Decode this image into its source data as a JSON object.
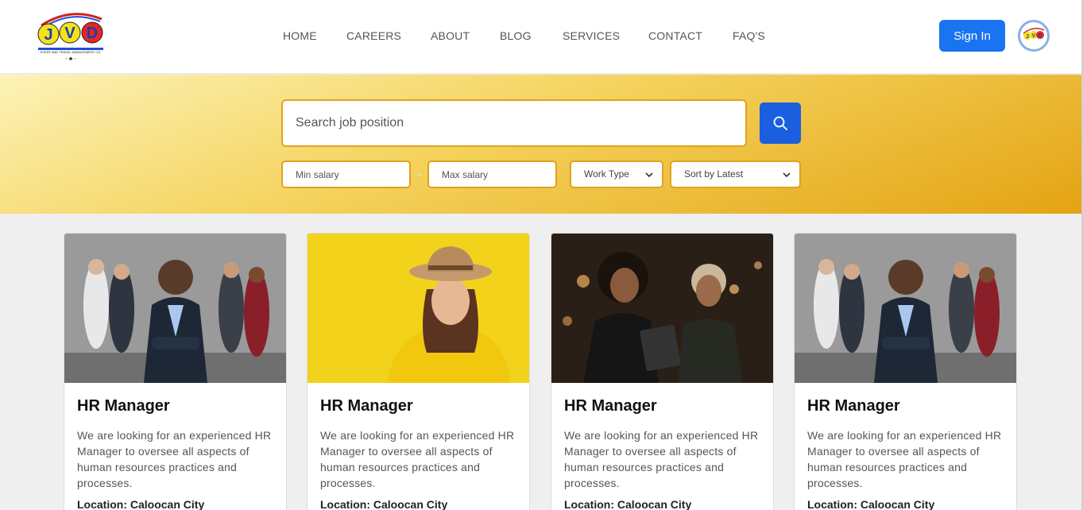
{
  "brand": {
    "logo_text": "JVD",
    "logo_tagline": "EVENT AND TRAVEL MANAGEMENT CO."
  },
  "nav": {
    "items": [
      {
        "label": "HOME"
      },
      {
        "label": "CAREERS"
      },
      {
        "label": "ABOUT"
      },
      {
        "label": "BLOG"
      },
      {
        "label": "SERVICES"
      },
      {
        "label": "CONTACT"
      },
      {
        "label": "FAQ'S"
      }
    ],
    "signin_label": "Sign In"
  },
  "search": {
    "placeholder": "Search job position",
    "min_salary_placeholder": "Min salary",
    "max_salary_placeholder": "Max salary",
    "range_separator": "-",
    "work_type": "Work Type",
    "sort": "Sort by Latest",
    "icon": "search-icon"
  },
  "colors": {
    "accent_blue": "#1a73f0",
    "hero_gold": "#e4a313",
    "border_gold": "#e2a21a"
  },
  "jobs": [
    {
      "title": "HR Manager",
      "description": "We are looking for an experienced HR Manager to oversee all aspects of human resources practices and processes.",
      "location": "Location: Caloocan City",
      "image": "group-office-team-photo"
    },
    {
      "title": "HR Manager",
      "description": "We are looking for an experienced HR Manager to oversee all aspects of human resources practices and processes.",
      "location": "Location: Caloocan City",
      "image": "woman-yellow-hat-photo"
    },
    {
      "title": "HR Manager",
      "description": "We are looking for an experienced HR Manager to oversee all aspects of human resources practices and processes.",
      "location": "Location: Caloocan City",
      "image": "two-women-tablet-photo"
    },
    {
      "title": "HR Manager",
      "description": "We are looking for an experienced HR Manager to oversee all aspects of human resources practices and processes.",
      "location": "Location: Caloocan City",
      "image": "group-office-team-photo"
    }
  ]
}
